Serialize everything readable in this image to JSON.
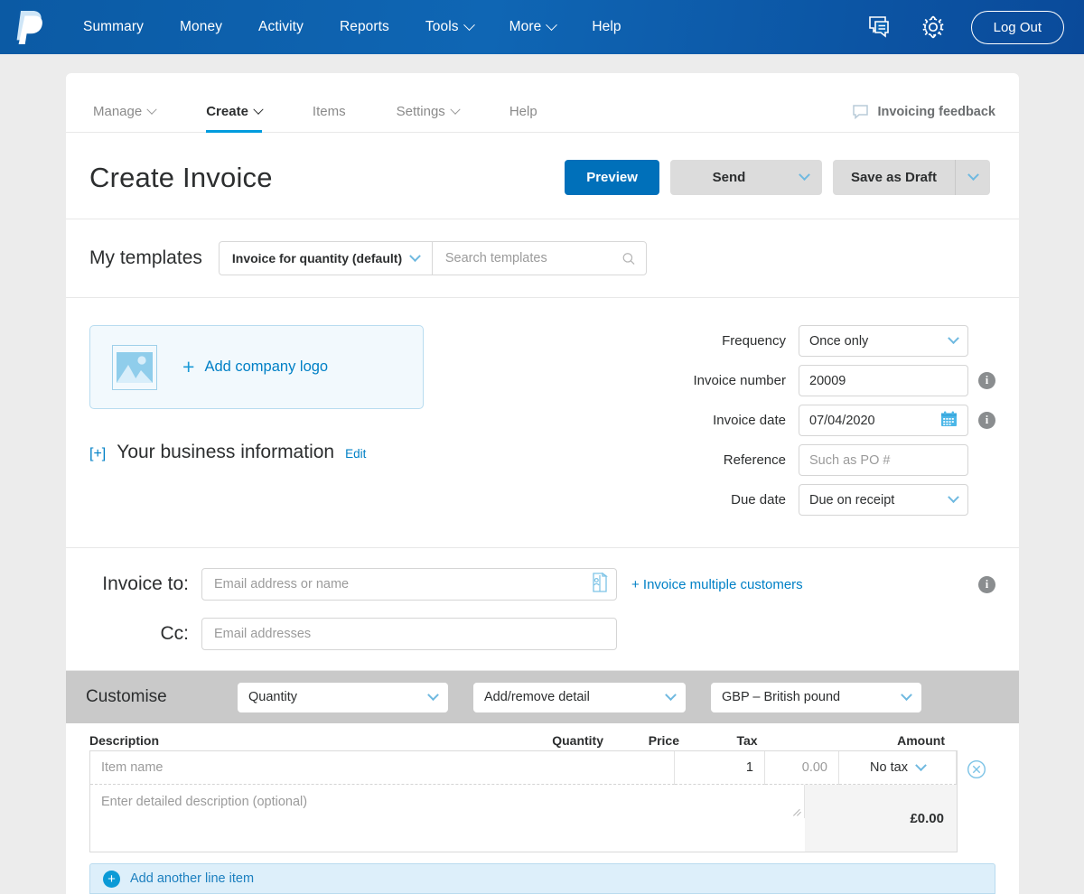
{
  "topnav": {
    "logo": "paypal-logo",
    "items": [
      {
        "label": "Summary",
        "caret": false
      },
      {
        "label": "Money",
        "caret": false
      },
      {
        "label": "Activity",
        "caret": false
      },
      {
        "label": "Reports",
        "caret": false
      },
      {
        "label": "Tools",
        "caret": true
      },
      {
        "label": "More",
        "caret": true
      },
      {
        "label": "Help",
        "caret": false
      }
    ],
    "message_icon": "message-icon",
    "settings_icon": "gear-icon",
    "logout_label": "Log Out",
    "bg_color": "#0f66b4"
  },
  "subnav": {
    "tabs": [
      {
        "label": "Manage",
        "caret": true,
        "active": false
      },
      {
        "label": "Create",
        "caret": true,
        "active": true
      },
      {
        "label": "Items",
        "caret": false,
        "active": false
      },
      {
        "label": "Settings",
        "caret": true,
        "active": false
      },
      {
        "label": "Help",
        "caret": false,
        "active": false
      }
    ],
    "feedback_label": "Invoicing feedback",
    "feedback_icon": "speech-bubble-icon",
    "active_underline_color": "#009cde"
  },
  "header": {
    "title": "Create Invoice",
    "preview_label": "Preview",
    "send_label": "Send",
    "save_draft_label": "Save as Draft",
    "primary_color": "#0070ba"
  },
  "templates": {
    "label": "My templates",
    "selected": "Invoice for quantity (default)",
    "search_placeholder": "Search templates",
    "search_value": "",
    "search_icon": "search-icon"
  },
  "logo_upload": {
    "cta": "Add company logo",
    "image_icon": "image-placeholder-icon",
    "plus_icon": "plus-icon",
    "bg_color": "#f2f9fd",
    "border_color": "#b8dcf0"
  },
  "business_info": {
    "expand": "[+]",
    "title": "Your business information",
    "edit_label": "Edit"
  },
  "invoice_fields": [
    {
      "label": "Frequency",
      "type": "select",
      "value": "Once only",
      "placeholder": "",
      "info": false,
      "icon": ""
    },
    {
      "label": "Invoice number",
      "type": "text",
      "value": "20009",
      "placeholder": "",
      "info": true,
      "icon": ""
    },
    {
      "label": "Invoice date",
      "type": "text",
      "value": "07/04/2020",
      "placeholder": "",
      "info": true,
      "icon": "calendar-icon"
    },
    {
      "label": "Reference",
      "type": "text",
      "value": "",
      "placeholder": "Such as PO #",
      "info": false,
      "icon": ""
    },
    {
      "label": "Due date",
      "type": "select",
      "value": "Due on receipt",
      "placeholder": "",
      "info": false,
      "icon": ""
    }
  ],
  "recipients": {
    "invoice_to_label": "Invoice to:",
    "invoice_to_placeholder": "Email address or name",
    "invoice_to_value": "",
    "contacts_icon": "address-book-icon",
    "multiple_link": "+ Invoice multiple customers",
    "cc_label": "Cc:",
    "cc_placeholder": "Email addresses",
    "cc_value": ""
  },
  "customise": {
    "label": "Customise",
    "bar_color": "#c9c9c9",
    "selects": [
      {
        "name": "quantity-mode",
        "value": "Quantity"
      },
      {
        "name": "detail-options",
        "value": "Add/remove detail"
      },
      {
        "name": "currency",
        "value": "GBP – British pound"
      }
    ]
  },
  "line_items": {
    "columns": [
      "Description",
      "Quantity",
      "Price",
      "Tax",
      "Amount"
    ],
    "rows": [
      {
        "description_placeholder": "Item name",
        "description_value": "",
        "quantity": "1",
        "price": "0.00",
        "tax": "No tax",
        "amount": "£0.00",
        "long_description_placeholder": "Enter detailed description (optional)",
        "long_description_value": "",
        "delete_icon": "remove-circle-icon"
      }
    ],
    "add_label": "Add another line item",
    "add_icon": "plus-circle-icon"
  }
}
